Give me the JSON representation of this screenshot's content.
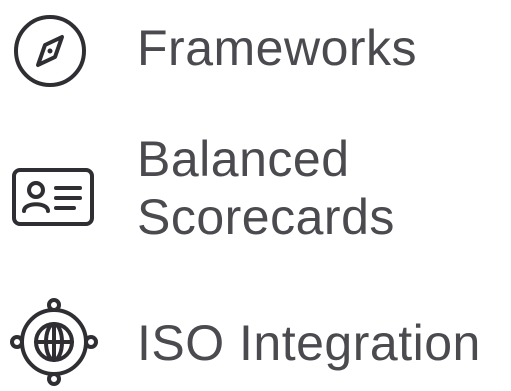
{
  "nav": {
    "items": [
      {
        "label": "Frameworks",
        "icon": "compass-icon"
      },
      {
        "label_lines": [
          "Balanced",
          "Scorecards"
        ],
        "icon": "id-card-icon"
      },
      {
        "label": "ISO Integration",
        "icon": "globe-network-icon"
      }
    ]
  },
  "colors": {
    "text": "#4a4a4f",
    "icon": "#2e2e33",
    "background": "#ffffff"
  }
}
